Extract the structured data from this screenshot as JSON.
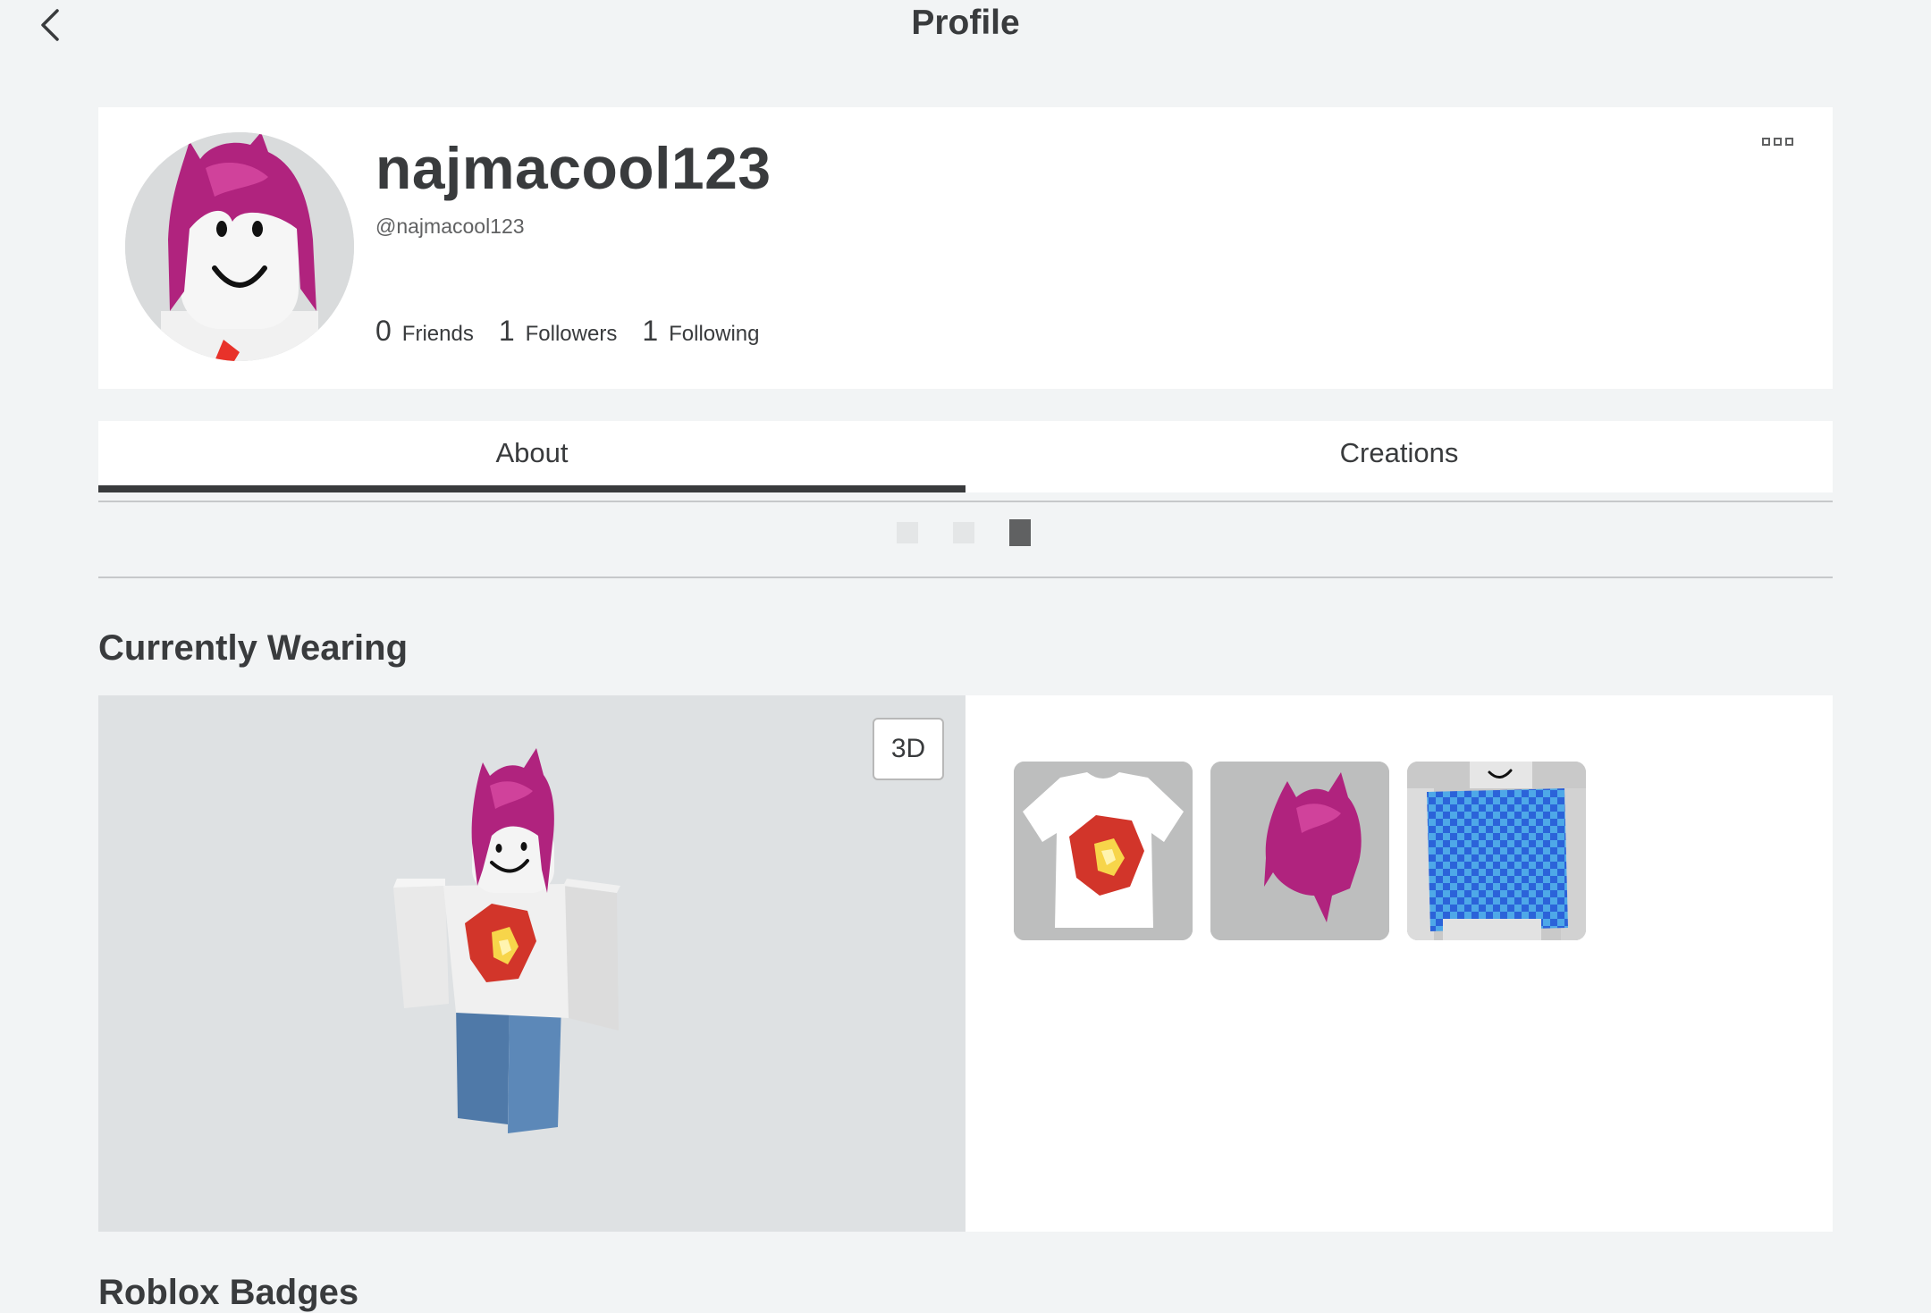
{
  "header": {
    "title": "Profile"
  },
  "profile": {
    "display_name": "najmacool123",
    "username": "@najmacool123",
    "stats": [
      {
        "count": "0",
        "label": "Friends"
      },
      {
        "count": "1",
        "label": "Followers"
      },
      {
        "count": "1",
        "label": "Following"
      }
    ]
  },
  "tabs": [
    {
      "label": "About",
      "active": true
    },
    {
      "label": "Creations",
      "active": false
    }
  ],
  "pager": {
    "count": 3,
    "active_index": 2
  },
  "sections": {
    "currently_wearing": "Currently Wearing",
    "badges": "Roblox Badges"
  },
  "wearing": {
    "view_toggle_label": "3D",
    "items": [
      {
        "name": "t-shirt-icon"
      },
      {
        "name": "pink-hair-icon"
      },
      {
        "name": "blue-checkered-shirt-icon"
      }
    ]
  },
  "colors": {
    "hair": "#b0237e",
    "hair_light": "#d0429b",
    "pants": "#5c88b8",
    "background": "#f2f4f5",
    "checker_dark": "#2b63d9",
    "checker_light": "#4ea8e8"
  }
}
